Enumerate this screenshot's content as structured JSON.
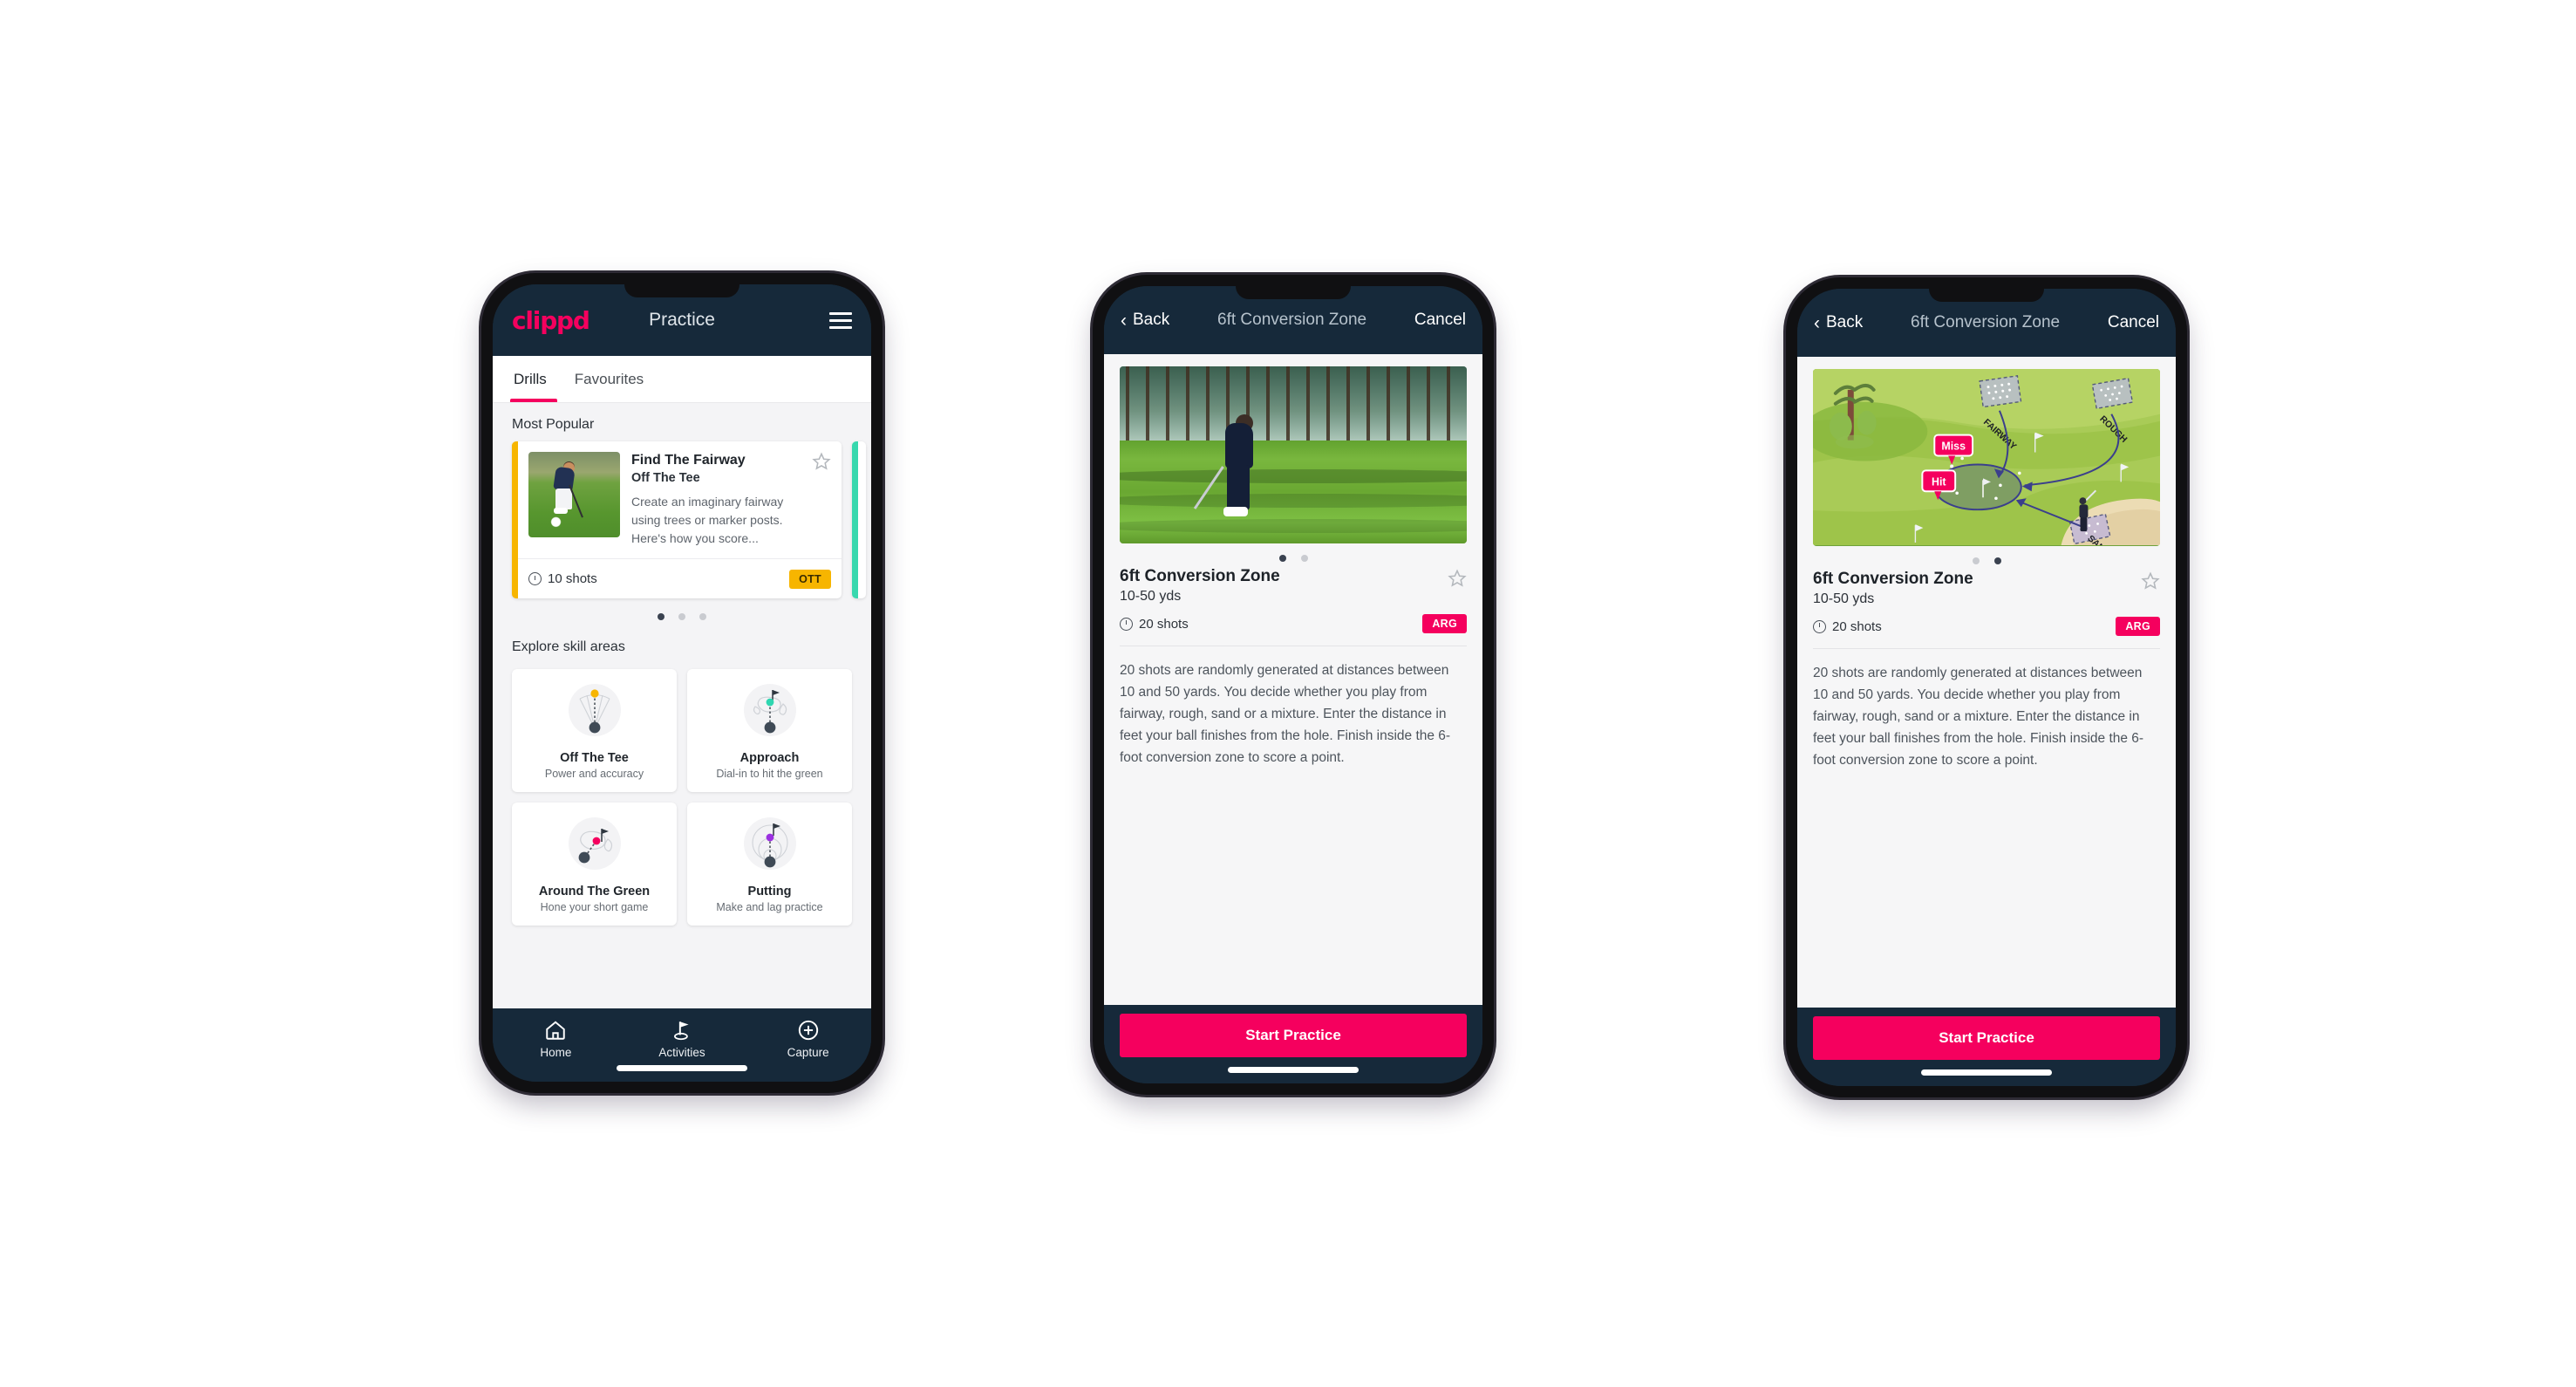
{
  "phone1": {
    "appbar": {
      "logo": "clippd",
      "title": "Practice",
      "menu_icon": "hamburger-icon"
    },
    "tabs": [
      {
        "label": "Drills",
        "active": true
      },
      {
        "label": "Favourites",
        "active": false
      }
    ],
    "sections": {
      "most_popular": "Most Popular",
      "explore": "Explore skill areas"
    },
    "featured_drill": {
      "name": "Find The Fairway",
      "category": "Off The Tee",
      "description": "Create an imaginary fairway using trees or marker posts. Here's how you score...",
      "shots": "10 shots",
      "badge": "OTT",
      "badge_color": "#f7b500",
      "accent_color": "#f7b500",
      "next_card_accent": "#37d8ae",
      "favourite": false
    },
    "carousel_dots": {
      "count": 3,
      "active": 0
    },
    "skill_areas": [
      {
        "name": "Off The Tee",
        "sub": "Power and accuracy",
        "icon": "tee-fan-icon",
        "dot_color": "#f7b500"
      },
      {
        "name": "Approach",
        "sub": "Dial-in to hit the green",
        "icon": "green-approach-icon",
        "dot_color": "#2ed6b0"
      },
      {
        "name": "Around The Green",
        "sub": "Hone your short game",
        "icon": "chip-icon",
        "dot_color": "#f5005e"
      },
      {
        "name": "Putting",
        "sub": "Make and lag practice",
        "icon": "putting-rings-icon",
        "dot_color": "#9b30e0"
      }
    ],
    "bottom_nav": [
      {
        "label": "Home",
        "icon": "home-icon",
        "active": false
      },
      {
        "label": "Activities",
        "icon": "golf-flag-icon",
        "active": true
      },
      {
        "label": "Capture",
        "icon": "plus-circle-icon",
        "active": false
      }
    ]
  },
  "phone2": {
    "modalbar": {
      "back": "Back",
      "title": "6ft Conversion Zone",
      "cancel": "Cancel"
    },
    "media": {
      "type": "video-still",
      "alt": "golfer chipping on fairway"
    },
    "carousel_dots": {
      "count": 2,
      "active": 0
    },
    "detail": {
      "title": "6ft Conversion Zone",
      "sub": "10-50 yds",
      "shots": "20 shots",
      "badge": "ARG",
      "badge_color": "#f5005e",
      "favourite": false,
      "description": "20 shots are randomly generated at distances between 10 and 50 yards. You decide whether you play from fairway, rough, sand or a mixture. Enter the distance in feet your ball finishes from the hole. Finish inside the 6-foot conversion zone to score a point."
    },
    "cta": "Start Practice"
  },
  "phone3": {
    "modalbar": {
      "back": "Back",
      "title": "6ft Conversion Zone",
      "cancel": "Cancel"
    },
    "media": {
      "type": "illustration",
      "alt": "golf course diagram",
      "labels": [
        "FAIRWAY",
        "ROUGH",
        "SAND"
      ],
      "callouts": [
        "Miss",
        "Hit"
      ],
      "callout_color": "#f5005e"
    },
    "carousel_dots": {
      "count": 2,
      "active": 1
    },
    "detail": {
      "title": "6ft Conversion Zone",
      "sub": "10-50 yds",
      "shots": "20 shots",
      "badge": "ARG",
      "badge_color": "#f5005e",
      "favourite": false,
      "description": "20 shots are randomly generated at distances between 10 and 50 yards. You decide whether you play from fairway, rough, sand or a mixture. Enter the distance in feet your ball finishes from the hole. Finish inside the 6-foot conversion zone to score a point."
    },
    "cta": "Start Practice"
  }
}
